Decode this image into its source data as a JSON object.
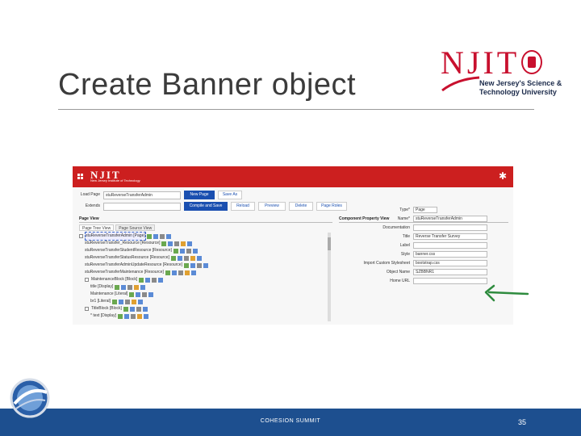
{
  "slide": {
    "title": "Create Banner object",
    "footer": "COHESION SUMMIT",
    "page_number": "35"
  },
  "logo": {
    "wordmark": "NJIT",
    "subtitle_line1": "New Jersey's Science &",
    "subtitle_line2": "Technology University"
  },
  "app": {
    "topbar_logo": "NJIT",
    "topbar_logo_sub": "New Jersey Institute of Technology",
    "accent_color": "#cc1f1f",
    "button_color": "#1a4fb0",
    "load_page_label": "Load Page",
    "load_page_value": "stuReverseTransferAdmin",
    "extends_label": "Extends",
    "buttons": {
      "new_page": "New Page",
      "save_as": "Save As",
      "compile_and_save": "Compile and Save",
      "reload": "Reload",
      "preview": "Preview",
      "delete": "Delete",
      "page_roles": "Page Roles"
    },
    "page_view_header": "Page View",
    "component_view_header": "Component Property View",
    "tabs": [
      "Page Tree View",
      "Page Source View"
    ],
    "tree": [
      {
        "text": "stuReverseTransferAdmin [Page]",
        "indent": 0,
        "toggle": true,
        "selected": true
      },
      {
        "text": "stuReverseTransfer_Resource [Resource]",
        "indent": 1,
        "toggle": false
      },
      {
        "text": "stuReverseTransferStudentResource [Resource]",
        "indent": 1,
        "toggle": false
      },
      {
        "text": "stuReverseTransferStatusResource [Resource]",
        "indent": 1,
        "toggle": false
      },
      {
        "text": "stuReverseTransferAdminUpdateResource [Resource]",
        "indent": 1,
        "toggle": false
      },
      {
        "text": "stuReverseTransferMaintenance [Resource]",
        "indent": 1,
        "toggle": false
      },
      {
        "text": "MaintenanceBlock [Block]",
        "indent": 1,
        "toggle": true
      },
      {
        "text": "title [Display]",
        "indent": 2,
        "toggle": false
      },
      {
        "text": "Maintenance [Literal]",
        "indent": 2,
        "toggle": false
      },
      {
        "text": "br1 [Literal]",
        "indent": 2,
        "toggle": false
      },
      {
        "text": "TitleBlock [Block]",
        "indent": 1,
        "toggle": true
      },
      {
        "text": "* text [Display]",
        "indent": 2,
        "toggle": false
      }
    ],
    "properties": [
      {
        "label": "Type*",
        "value": "Page"
      },
      {
        "label": "Name*",
        "value": "stuReverseTransferAdmin"
      },
      {
        "label": "Documentation",
        "value": ""
      },
      {
        "label": "Title",
        "value": "Reverse Transfer Survey"
      },
      {
        "label": "Label",
        "value": ""
      },
      {
        "label": "Style",
        "value": "banner.css"
      },
      {
        "label": "Import Custom Stylesheet",
        "value": "bootstrap.css"
      },
      {
        "label": "Object Name",
        "value": "SZBBNR1"
      },
      {
        "label": "Home URL",
        "value": ""
      }
    ]
  },
  "footer_color": "#1d4f8f",
  "arrow_color": "#2e8b3e"
}
